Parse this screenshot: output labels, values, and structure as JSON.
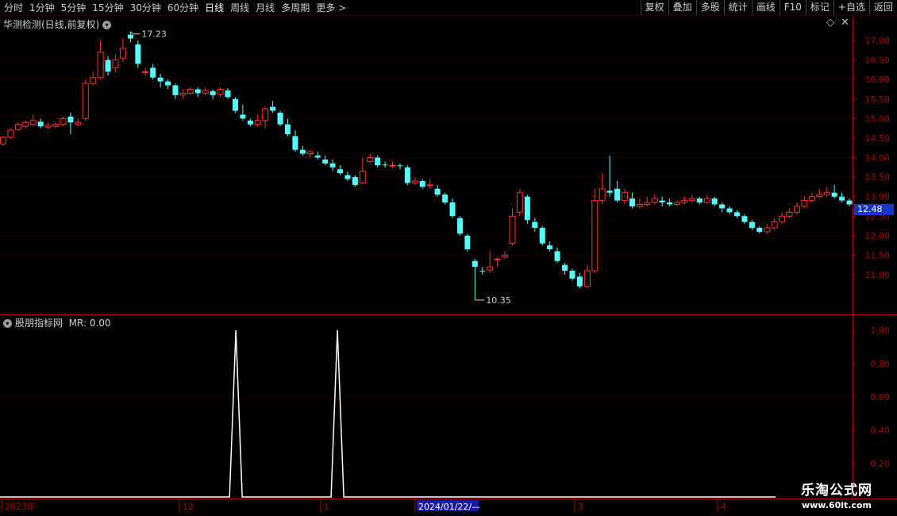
{
  "toolbar": {
    "periods": [
      "分时",
      "1分钟",
      "5分钟",
      "15分钟",
      "30分钟",
      "60分钟",
      "日线",
      "周线",
      "月线",
      "多周期",
      "更多 >"
    ],
    "active_period": "日线",
    "right_buttons": [
      "复权",
      "叠加",
      "多股",
      "统计",
      "画线",
      "F10",
      "标记",
      "+自选",
      "返回"
    ]
  },
  "main_panel": {
    "title": "华测检测(日线,前复权)",
    "high_label": "17.23",
    "low_label": "10.35",
    "last_price": "12.48"
  },
  "indicator_panel": {
    "title": "股朋指标网",
    "value_text": "MR: 0.00"
  },
  "x_axis": {
    "labels": [
      {
        "text": "2023年"
      },
      {
        "text": "12"
      },
      {
        "text": "1"
      },
      {
        "text": "2024/01/22/—",
        "highlight": true
      },
      {
        "text": "3"
      },
      {
        "text": "4"
      }
    ]
  },
  "watermark": {
    "line1": "乐淘公式网",
    "line2": "www.60lt.com"
  },
  "colors": {
    "up": "#ff3232",
    "down": "#54ffff",
    "axis": "#b00000",
    "grid": "#5a0000",
    "signal": "#ffffff",
    "price_tag": "#1a34c9"
  },
  "chart_data": [
    {
      "type": "candlestick",
      "ylim": [
        10.35,
        17.6
      ],
      "y_ticks": [
        "11.00",
        "11.50",
        "12.00",
        "12.50",
        "13.00",
        "13.50",
        "14.00",
        "14.50",
        "15.00",
        "15.50",
        "16.00",
        "16.50",
        "17.00"
      ],
      "candles": [
        [
          14.35,
          14.52,
          14.55,
          14.3
        ],
        [
          14.52,
          14.7,
          14.75,
          14.48
        ],
        [
          14.72,
          14.85,
          14.9,
          14.68
        ],
        [
          14.8,
          14.9,
          14.95,
          14.75
        ],
        [
          14.85,
          14.95,
          15.1,
          14.8
        ],
        [
          14.92,
          14.8,
          15.0,
          14.75
        ],
        [
          14.78,
          14.82,
          14.9,
          14.72
        ],
        [
          14.8,
          14.85,
          14.92,
          14.75
        ],
        [
          14.85,
          15.0,
          15.05,
          14.8
        ],
        [
          15.05,
          14.9,
          15.15,
          14.6
        ],
        [
          14.85,
          14.9,
          15.0,
          14.8
        ],
        [
          15.0,
          15.9,
          16.0,
          14.95
        ],
        [
          15.9,
          16.05,
          16.2,
          15.85
        ],
        [
          16.05,
          16.7,
          17.0,
          16.0
        ],
        [
          16.5,
          16.2,
          16.6,
          16.1
        ],
        [
          16.3,
          16.5,
          16.65,
          16.2
        ],
        [
          16.55,
          16.8,
          17.05,
          16.45
        ],
        [
          17.15,
          17.05,
          17.23,
          16.95
        ],
        [
          16.9,
          16.4,
          17.0,
          16.3
        ],
        [
          16.2,
          16.2,
          16.3,
          16.1
        ],
        [
          16.3,
          16.05,
          16.4,
          16.0
        ],
        [
          16.05,
          15.95,
          16.15,
          15.8
        ],
        [
          15.95,
          15.85,
          16.0,
          15.75
        ],
        [
          15.85,
          15.6,
          15.9,
          15.5
        ],
        [
          15.6,
          15.65,
          15.75,
          15.5
        ],
        [
          15.65,
          15.75,
          15.8,
          15.6
        ],
        [
          15.75,
          15.65,
          15.8,
          15.55
        ],
        [
          15.65,
          15.72,
          15.8,
          15.6
        ],
        [
          15.7,
          15.6,
          15.75,
          15.5
        ],
        [
          15.62,
          15.75,
          15.8,
          15.55
        ],
        [
          15.72,
          15.55,
          15.78,
          15.5
        ],
        [
          15.5,
          15.2,
          15.55,
          15.15
        ],
        [
          15.1,
          15.0,
          15.35,
          14.95
        ],
        [
          14.95,
          14.85,
          15.0,
          14.8
        ],
        [
          14.85,
          14.95,
          15.1,
          14.8
        ],
        [
          14.95,
          15.25,
          15.3,
          14.75
        ],
        [
          15.3,
          15.2,
          15.45,
          15.15
        ],
        [
          15.15,
          14.85,
          15.2,
          14.8
        ],
        [
          14.85,
          14.6,
          15.0,
          14.55
        ],
        [
          14.55,
          14.2,
          14.7,
          14.15
        ],
        [
          14.2,
          14.1,
          14.3,
          14.05
        ],
        [
          14.1,
          14.15,
          14.2,
          14.0
        ],
        [
          14.05,
          14.0,
          14.15,
          13.95
        ],
        [
          13.95,
          13.85,
          14.05,
          13.8
        ],
        [
          13.85,
          13.75,
          13.95,
          13.65
        ],
        [
          13.7,
          13.6,
          13.8,
          13.55
        ],
        [
          13.55,
          13.45,
          13.65,
          13.4
        ],
        [
          13.5,
          13.3,
          13.55,
          13.25
        ],
        [
          13.35,
          13.65,
          14.0,
          13.35
        ],
        [
          13.9,
          14.0,
          14.1,
          13.85
        ],
        [
          14.0,
          13.8,
          14.05,
          13.75
        ],
        [
          13.82,
          13.8,
          13.9,
          13.75
        ],
        [
          13.8,
          13.8,
          13.9,
          13.72
        ],
        [
          13.8,
          13.78,
          13.85,
          13.7
        ],
        [
          13.75,
          13.35,
          13.8,
          13.3
        ],
        [
          13.35,
          13.4,
          13.5,
          13.3
        ],
        [
          13.4,
          13.25,
          13.45,
          13.2
        ],
        [
          13.3,
          13.3,
          13.45,
          13.2
        ],
        [
          13.2,
          13.05,
          13.3,
          13.0
        ],
        [
          13.05,
          12.85,
          13.1,
          12.8
        ],
        [
          12.85,
          12.5,
          12.95,
          12.45
        ],
        [
          12.45,
          12.05,
          12.5,
          12.0
        ],
        [
          12.0,
          11.65,
          12.05,
          11.6
        ],
        [
          11.35,
          11.2,
          11.4,
          10.35
        ],
        [
          11.1,
          11.08,
          11.2,
          11.0
        ],
        [
          11.12,
          11.2,
          11.6,
          11.05
        ],
        [
          11.38,
          11.4,
          11.45,
          11.2
        ],
        [
          11.45,
          11.5,
          11.6,
          11.4
        ],
        [
          11.8,
          12.5,
          12.7,
          11.75
        ],
        [
          12.6,
          13.1,
          13.2,
          12.5
        ],
        [
          13.0,
          12.4,
          13.05,
          12.3
        ],
        [
          12.35,
          12.2,
          12.45,
          12.1
        ],
        [
          12.2,
          11.8,
          12.25,
          11.75
        ],
        [
          11.75,
          11.65,
          11.85,
          11.6
        ],
        [
          11.6,
          11.35,
          11.7,
          11.3
        ],
        [
          11.25,
          11.1,
          11.3,
          11.0
        ],
        [
          11.1,
          10.9,
          11.15,
          10.85
        ],
        [
          10.95,
          10.7,
          11.05,
          10.65
        ],
        [
          10.7,
          11.1,
          11.25,
          10.65
        ],
        [
          11.1,
          12.9,
          13.2,
          11.05
        ],
        [
          12.9,
          13.2,
          13.6,
          12.8
        ],
        [
          13.15,
          13.1,
          14.05,
          13.0
        ],
        [
          13.2,
          12.9,
          13.4,
          12.85
        ],
        [
          12.9,
          13.1,
          13.2,
          12.8
        ],
        [
          12.95,
          12.75,
          13.1,
          12.7
        ],
        [
          12.75,
          12.8,
          12.95,
          12.7
        ],
        [
          12.8,
          12.85,
          13.0,
          12.75
        ],
        [
          12.85,
          12.95,
          13.05,
          12.8
        ],
        [
          12.9,
          12.85,
          13.0,
          12.75
        ],
        [
          12.85,
          12.8,
          12.95,
          12.75
        ],
        [
          12.8,
          12.85,
          12.9,
          12.75
        ],
        [
          12.85,
          12.9,
          13.0,
          12.8
        ],
        [
          12.9,
          12.95,
          13.05,
          12.85
        ],
        [
          12.95,
          12.85,
          13.0,
          12.8
        ],
        [
          12.85,
          12.95,
          13.05,
          12.8
        ],
        [
          12.95,
          12.8,
          13.0,
          12.75
        ],
        [
          12.8,
          12.7,
          12.85,
          12.6
        ],
        [
          12.7,
          12.6,
          12.75,
          12.55
        ],
        [
          12.6,
          12.5,
          12.65,
          12.45
        ],
        [
          12.5,
          12.35,
          12.55,
          12.3
        ],
        [
          12.35,
          12.2,
          12.4,
          12.15
        ],
        [
          12.2,
          12.1,
          12.25,
          12.05
        ],
        [
          12.1,
          12.2,
          12.3,
          12.05
        ],
        [
          12.2,
          12.35,
          12.45,
          12.15
        ],
        [
          12.35,
          12.5,
          12.6,
          12.3
        ],
        [
          12.5,
          12.6,
          12.7,
          12.45
        ],
        [
          12.6,
          12.75,
          12.85,
          12.55
        ],
        [
          12.75,
          12.9,
          13.0,
          12.7
        ],
        [
          12.9,
          13.0,
          13.1,
          12.85
        ],
        [
          13.0,
          13.05,
          13.2,
          12.95
        ],
        [
          13.05,
          13.1,
          13.25,
          13.0
        ],
        [
          13.1,
          13.0,
          13.3,
          12.95
        ],
        [
          13.0,
          12.9,
          13.1,
          12.85
        ],
        [
          12.9,
          12.8,
          12.95,
          12.75
        ]
      ]
    },
    {
      "type": "line",
      "series": [
        {
          "name": "MR",
          "peaks": [
            0.275,
            0.395
          ]
        }
      ],
      "ylim": [
        0,
        1.05
      ],
      "y_ticks": [
        "1.00",
        "0.80",
        "0.60",
        "0.40",
        "0.20"
      ]
    }
  ]
}
